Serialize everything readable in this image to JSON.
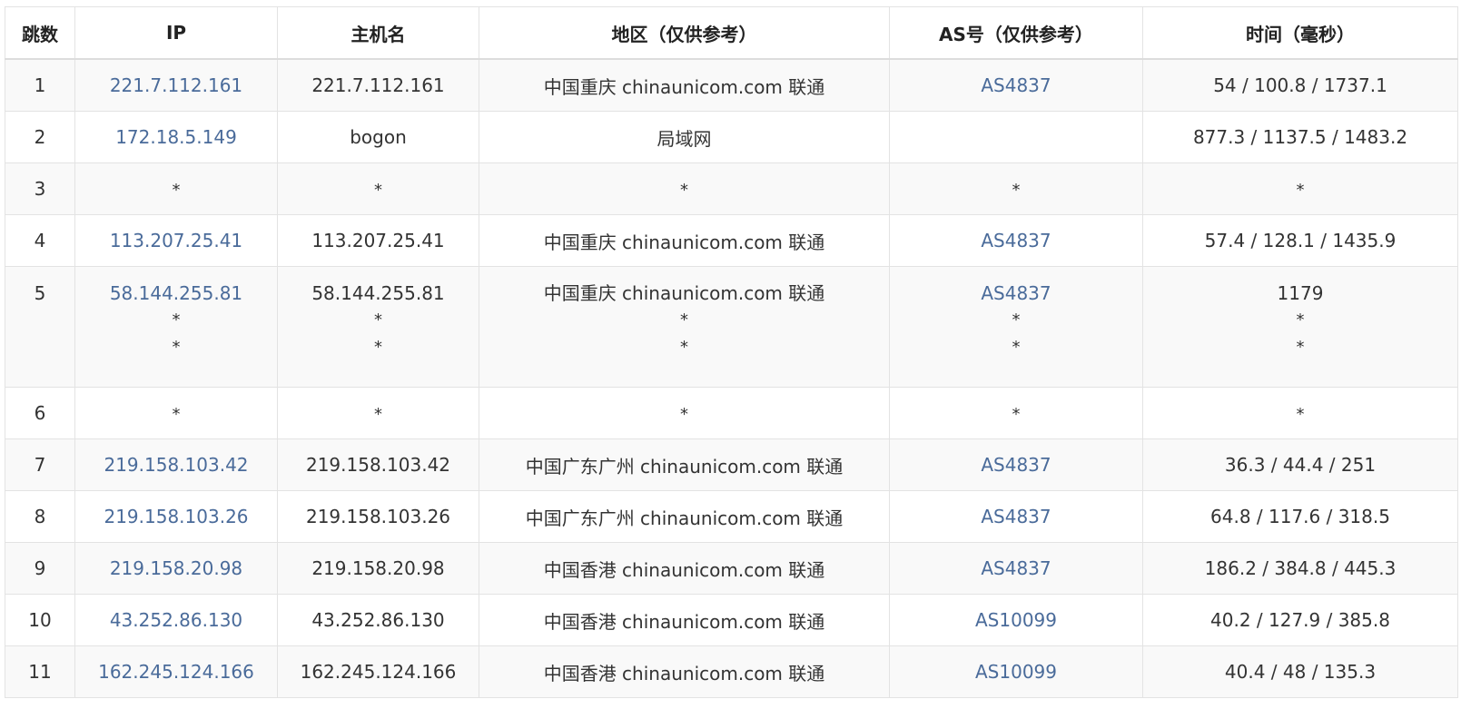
{
  "table": {
    "headers": [
      "跳数",
      "IP",
      "主机名",
      "地区（仅供参考）",
      "AS号（仅供参考）",
      "时间（毫秒）"
    ],
    "rows": [
      {
        "hop": "1",
        "ip": "221.7.112.161",
        "host": "221.7.112.161",
        "region": "中国重庆 chinaunicom.com 联通",
        "asn": "AS4837",
        "time": "54 / 100.8 / 1737.1"
      },
      {
        "hop": "2",
        "ip": "172.18.5.149",
        "host": "bogon",
        "region": "局域网",
        "asn": "",
        "time": "877.3 / 1137.5 / 1483.2"
      },
      {
        "hop": "3",
        "ip": "*",
        "host": "*",
        "region": "*",
        "asn": "*",
        "time": "*"
      },
      {
        "hop": "4",
        "ip": "113.207.25.41",
        "host": "113.207.25.41",
        "region": "中国重庆 chinaunicom.com 联通",
        "asn": "AS4837",
        "time": "57.4 / 128.1 / 1435.9"
      },
      {
        "hop": "5",
        "ip": [
          "58.144.255.81",
          "*",
          "*"
        ],
        "host": [
          "58.144.255.81",
          "*",
          "*"
        ],
        "region": [
          "中国重庆 chinaunicom.com 联通",
          "*",
          "*"
        ],
        "asn": [
          "AS4837",
          "*",
          "*"
        ],
        "time": [
          "1179",
          "*",
          "*"
        ]
      },
      {
        "hop": "6",
        "ip": "*",
        "host": "*",
        "region": "*",
        "asn": "*",
        "time": "*"
      },
      {
        "hop": "7",
        "ip": "219.158.103.42",
        "host": "219.158.103.42",
        "region": "中国广东广州 chinaunicom.com 联通",
        "asn": "AS4837",
        "time": "36.3 / 44.4 / 251"
      },
      {
        "hop": "8",
        "ip": "219.158.103.26",
        "host": "219.158.103.26",
        "region": "中国广东广州 chinaunicom.com 联通",
        "asn": "AS4837",
        "time": "64.8 / 117.6 / 318.5"
      },
      {
        "hop": "9",
        "ip": "219.158.20.98",
        "host": "219.158.20.98",
        "region": "中国香港 chinaunicom.com 联通",
        "asn": "AS4837",
        "time": "186.2 / 384.8 / 445.3"
      },
      {
        "hop": "10",
        "ip": "43.252.86.130",
        "host": "43.252.86.130",
        "region": "中国香港 chinaunicom.com 联通",
        "asn": "AS10099",
        "time": "40.2 / 127.9 / 385.8"
      },
      {
        "hop": "11",
        "ip": "162.245.124.166",
        "host": "162.245.124.166",
        "region": "中国香港 chinaunicom.com 联通",
        "asn": "AS10099",
        "time": "40.4 / 48 / 135.3"
      }
    ]
  },
  "colors": {
    "link": "#4a6b9a",
    "text": "#333333",
    "border": "#e3e3e3",
    "stripe": "#f9f9f9"
  }
}
